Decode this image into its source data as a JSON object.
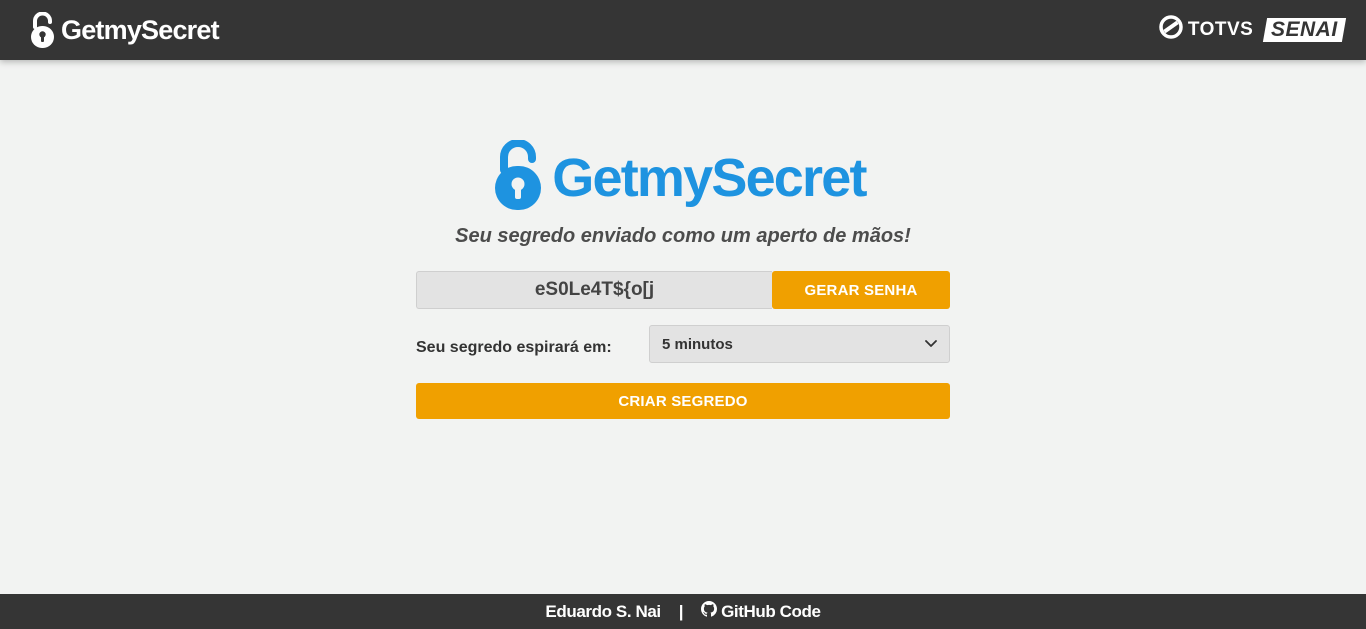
{
  "header": {
    "brand": "GetmySecret",
    "partner_totvs": "TOTVS",
    "partner_senai": "SENAI"
  },
  "hero": {
    "brand": "GetmySecret",
    "tagline": "Seu segredo enviado como um aperto de mãos!"
  },
  "form": {
    "password_value": "eS0Le4T${o[j",
    "generate_label": "GERAR SENHA",
    "expire_label": "Seu segredo espirará em:",
    "expire_selected": "5 minutos",
    "create_label": "CRIAR SEGREDO"
  },
  "footer": {
    "author": "Eduardo S. Nai",
    "separator": "|",
    "github_label": "GitHub Code"
  },
  "colors": {
    "brand_blue": "#1e93e0",
    "accent_orange": "#f0a000",
    "bar_dark": "#353535",
    "background": "#f2f3f2"
  },
  "icons": [
    "unlocked-padlock-icon",
    "totvs-logo-icon",
    "chevron-down-icon",
    "github-icon"
  ]
}
